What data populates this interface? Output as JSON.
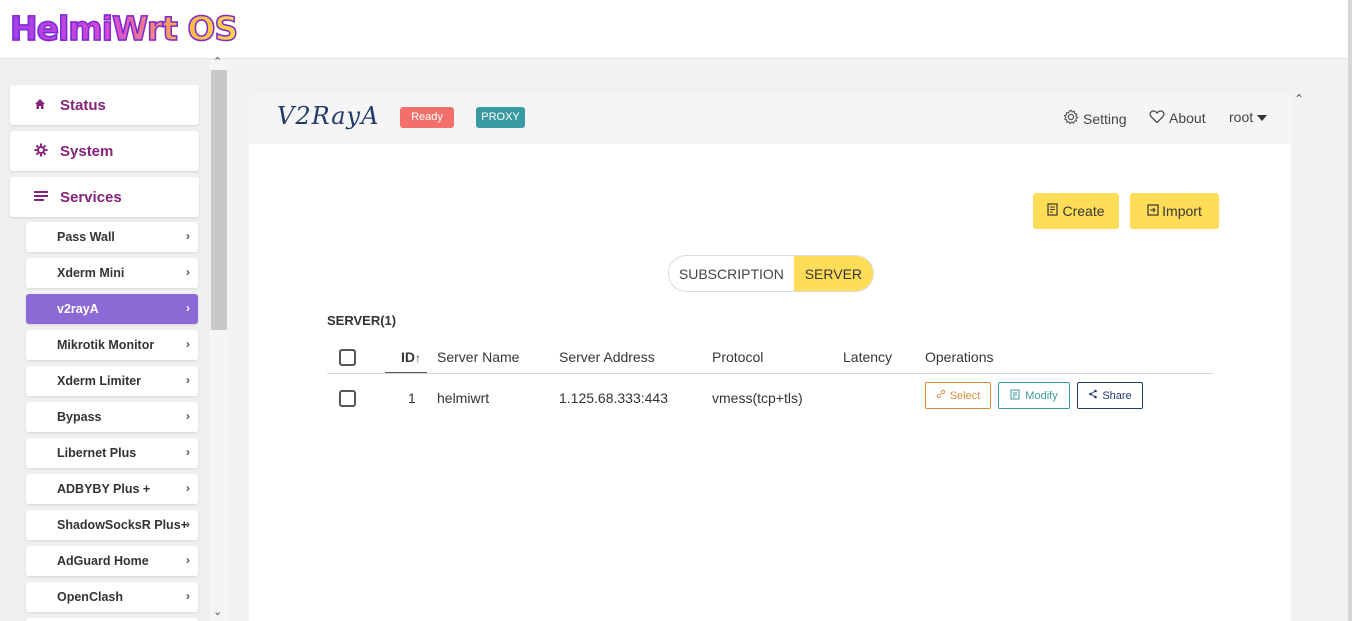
{
  "header": {
    "logo_text": "HelmiWrt OS"
  },
  "sidebar": {
    "main_items": [
      {
        "label": "Status",
        "icon": "home-icon"
      },
      {
        "label": "System",
        "icon": "gear-icon"
      },
      {
        "label": "Services",
        "icon": "list-icon"
      }
    ],
    "sub_items": [
      {
        "label": "Pass Wall"
      },
      {
        "label": "Xderm Mini"
      },
      {
        "label": "v2rayA",
        "active": true
      },
      {
        "label": "Mikrotik Monitor"
      },
      {
        "label": "Xderm Limiter"
      },
      {
        "label": "Bypass"
      },
      {
        "label": "Libernet Plus"
      },
      {
        "label": "ADBYBY Plus +"
      },
      {
        "label": "ShadowSocksR Plus+"
      },
      {
        "label": "AdGuard Home"
      },
      {
        "label": "OpenClash"
      }
    ]
  },
  "app": {
    "brand": "V2RayA",
    "status_badge": "Ready",
    "mode_badge": "PROXY",
    "nav": {
      "setting": "Setting",
      "about": "About",
      "user": "root"
    },
    "actions": {
      "create": "Create",
      "import": "Import"
    },
    "tabs": {
      "subscription": "SUBSCRIPTION",
      "server": "SERVER",
      "active": "SERVER"
    },
    "section_title": "SERVER(1)",
    "table": {
      "columns": [
        "ID",
        "Server Name",
        "Server Address",
        "Protocol",
        "Latency",
        "Operations"
      ],
      "rows": [
        {
          "id": "1",
          "name": "helmiwrt",
          "address": "1.125.68.333:443",
          "protocol": "vmess(tcp+tls)",
          "latency": ""
        }
      ],
      "operations": {
        "select": "Select",
        "modify": "Modify",
        "share": "Share"
      }
    }
  },
  "colors": {
    "accent_purple": "#86237a",
    "active_item": "#8c6ad6",
    "yellow": "#ffdd57",
    "ready": "#f2706b",
    "proxy": "#3a9aa1"
  }
}
